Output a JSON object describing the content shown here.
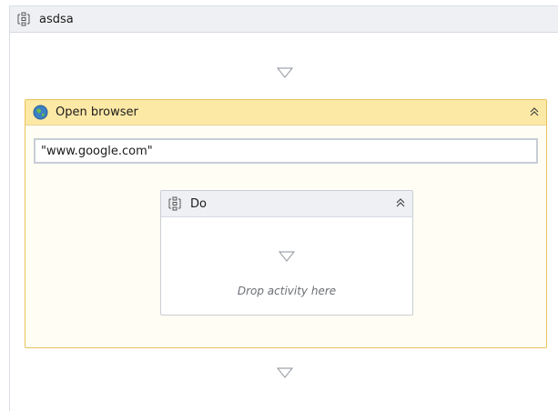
{
  "sequence": {
    "title": "asdsa",
    "icon": "sequence-icon"
  },
  "open_browser": {
    "title": "Open browser",
    "icon": "globe-icon",
    "url_value": "\"www.google.com\"",
    "collapse_icon": "double-chevron-up-icon"
  },
  "do_block": {
    "title": "Do",
    "icon": "sequence-icon",
    "collapse_icon": "double-chevron-up-icon",
    "drop_hint": "Drop activity here"
  },
  "colors": {
    "header_bg": "#eef0f3",
    "browser_header_bg": "#fde9a6",
    "browser_border": "#e8c35a",
    "arrow": "#8a9099"
  }
}
